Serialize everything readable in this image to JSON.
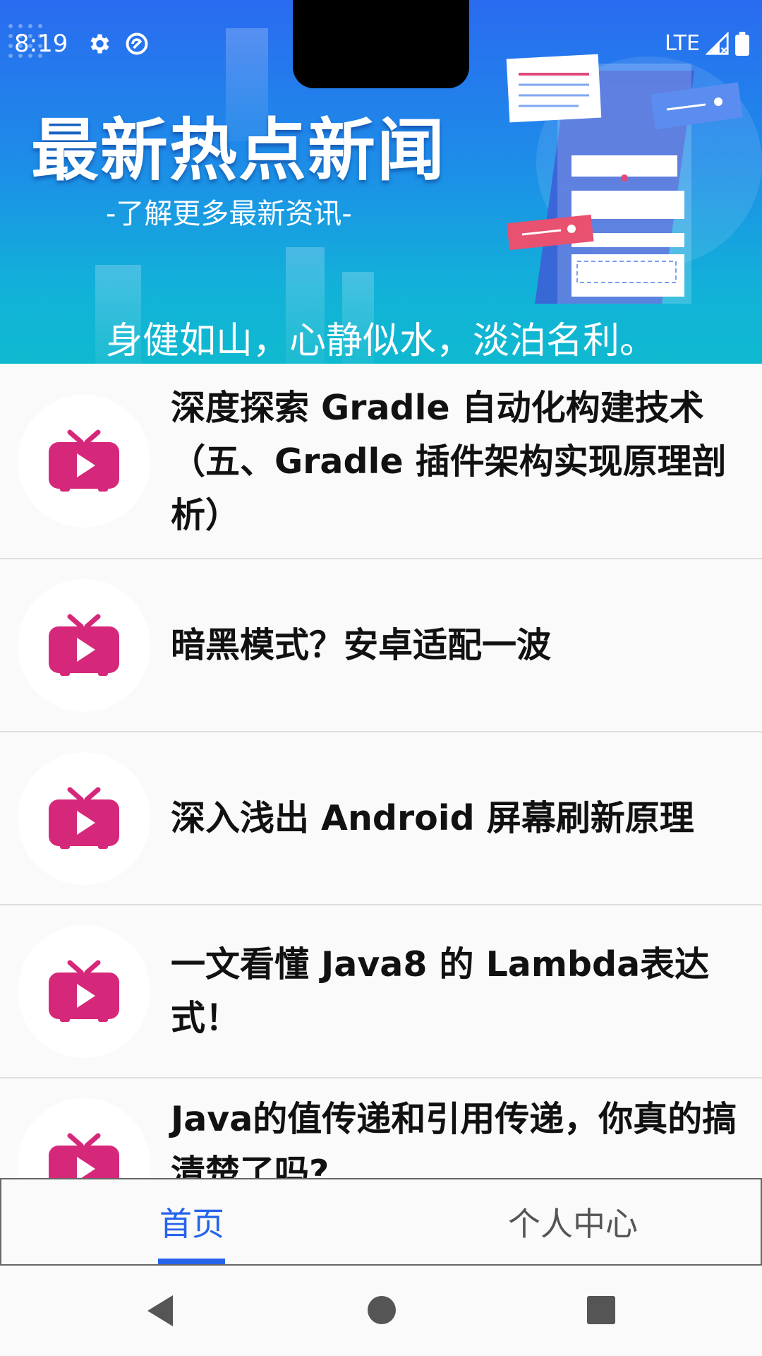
{
  "status": {
    "time": "8:19",
    "network": "LTE"
  },
  "banner": {
    "headline": "最新热点新闻",
    "subhead": "-了解更多最新资讯-",
    "motto": "身健如山，心静似水，淡泊名利。"
  },
  "articles": [
    {
      "title": "深度探索 Gradle 自动化构建技术（五、Gradle 插件架构实现原理剖析）"
    },
    {
      "title": "暗黑模式？安卓适配一波"
    },
    {
      "title": "深入浅出 Android 屏幕刷新原理"
    },
    {
      "title": "一文看懂 Java8 的 Lambda表达式！"
    },
    {
      "title": "Java的值传递和引用传递，你真的搞清楚了吗?"
    }
  ],
  "tabs": [
    {
      "label": "首页"
    },
    {
      "label": "个人中心"
    }
  ],
  "colors": {
    "accent": "#2563eb",
    "tv_icon": "#d6287a",
    "inactive_tab": "#555555"
  }
}
